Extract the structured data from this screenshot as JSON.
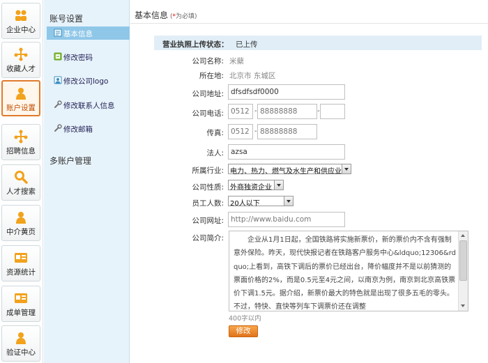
{
  "leftnav": {
    "items": [
      {
        "label": "企业中心",
        "icon": "people-icon",
        "color": "#f2a21b"
      },
      {
        "label": "收藏人才",
        "icon": "network-icon",
        "color": "#f2a21b"
      },
      {
        "label": "账户设置",
        "icon": "user-icon",
        "color": "#f2a21b",
        "active": true
      },
      {
        "label": "招聘信息",
        "icon": "network-icon",
        "color": "#f2a21b"
      },
      {
        "label": "人才搜索",
        "icon": "search-icon",
        "color": "#f2a21b"
      },
      {
        "label": "中介黄页",
        "icon": "user-icon",
        "color": "#f2a21b"
      },
      {
        "label": "资源统计",
        "icon": "card-icon",
        "color": "#f2a21b"
      },
      {
        "label": "成单管理",
        "icon": "card-icon",
        "color": "#f2a21b"
      },
      {
        "label": "验证中心",
        "icon": "user-icon",
        "color": "#f2a21b"
      }
    ]
  },
  "sidebar": {
    "title": "账号设置",
    "items": [
      {
        "label": "基本信息",
        "icon": "document-icon",
        "active": true
      },
      {
        "label": "修改密码",
        "icon": "key-card-icon"
      },
      {
        "label": "修改公司logo",
        "icon": "user-card-icon"
      },
      {
        "label": "修改联系人信息",
        "icon": "wrench-icon"
      },
      {
        "label": "修改邮箱",
        "icon": "wrench-icon"
      }
    ],
    "section2": "多账户管理"
  },
  "header": {
    "title": "基本信息",
    "required_prefix": "(",
    "required_star": "*",
    "required_text": "为必填)"
  },
  "license": {
    "label": "营业执照上传状态：",
    "value": "已上传"
  },
  "form": {
    "company_name": {
      "label": "公司名称:",
      "value": "米蘖"
    },
    "location": {
      "label": "所在地:",
      "value": "北京市 东城区"
    },
    "address": {
      "label": "公司地址:",
      "value": "dfsdfsdf0000"
    },
    "phone": {
      "label": "公司电话:",
      "area": "0512",
      "number": "88888888",
      "ext": "",
      "dash": "-"
    },
    "fax": {
      "label": "传真:",
      "area": "0512",
      "number": "88888888",
      "dash": "-"
    },
    "legal": {
      "label": "法人:",
      "value": "azsa"
    },
    "industry": {
      "label": "所属行业:",
      "value": "电力、热力、燃气及水生产和供应业"
    },
    "nature": {
      "label": "公司性质:",
      "value": "外商独资企业"
    },
    "staff": {
      "label": "员工人数:",
      "value": "20人以下"
    },
    "website": {
      "label": "公司网址:",
      "value": "http://www.baidu.com"
    },
    "intro": {
      "label": "公司简介:",
      "text": "企业从1月1日起，全国铁路将实施新票价，新的票价内不含有强制意外保险。昨天，现代快报记者在铁路客户服务中心&ldquo;12306&rdquo;上看到，高铁下调后的票价已经出台，降价幅度并不是以前猜测的票面价格的2%，而是0.5元至4元之间，以南京为例，南京到北京高铁票价下调1.5元。据介绍，新票价最大的特色就是出现了很多五毛的零头。不过，特快、直快等列车下调票价还在调整"
    },
    "limit": "400字以内",
    "save_label": "修改"
  }
}
